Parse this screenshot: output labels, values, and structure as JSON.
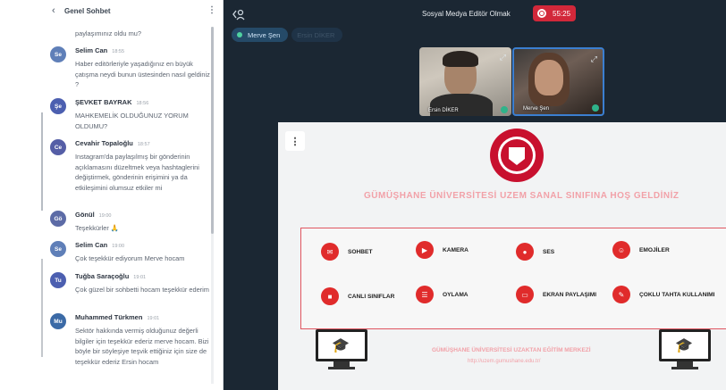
{
  "chat": {
    "title": "Genel Sohbet",
    "partial_text": "paylaşımınız oldu mu?",
    "messages": [
      {
        "initials": "Se",
        "name": "Selim Can",
        "time": "18:55",
        "text": "Haber editörleriyle yaşadığınız en büyük çatışma neydi bunun üstesinden nasıl geldiniz ?",
        "color": "#5f7fb8"
      },
      {
        "initials": "Şe",
        "name": "ŞEVKET BAYRAK",
        "time": "18:56",
        "text": "MAHKEMELİK OLDUĞUNUZ YORUM OLDUMU?",
        "color": "#4c5fb0"
      },
      {
        "initials": "Ce",
        "name": "Cevahir Topaloğlu",
        "time": "18:57",
        "text": "Instagram'da paylaşılmış bir gönderinin açıklamasını düzeltmek veya hashtaglerini değiştirmek, gönderinin erişimini ya da etkileşimini olumsuz etkiler mi",
        "color": "#555ea6"
      },
      {
        "initials": "Gö",
        "name": "Gönül",
        "time": "19:00",
        "text": "Teşekkürler 🙏",
        "color": "#5c6ba6"
      },
      {
        "initials": "Se",
        "name": "Selim Can",
        "time": "19:00",
        "text": "Çok teşekkür ediyorum Merve hocam",
        "color": "#5f7fb8"
      },
      {
        "initials": "Tu",
        "name": "Tuğba Saraçoğlu",
        "time": "19:01",
        "text": "Çok güzel bir sohbetti hocam teşekkür ederim",
        "color": "#4c5fb0"
      },
      {
        "initials": "Mu",
        "name": "Muhammed Türkmen",
        "time": "19:01",
        "text": "Sektör hakkında vermiş olduğunuz değerli bilgiler için teşekkür ederiz merve hocam. Bizi böyle bir söyleşiye teşvik ettiğiniz için size de teşekkür ederiz Ersin hocam",
        "color": "#3b6aa6"
      }
    ]
  },
  "room": {
    "title": "Sosyal Medya Editör Olmak",
    "timer": "55:25",
    "presenters": [
      "Merve Şen",
      "Ersin DİKER"
    ]
  },
  "videos": [
    {
      "label": "Ersin DİKER"
    },
    {
      "label": "Merve Şen"
    }
  ],
  "slide": {
    "welcome": "GÜMÜŞHANE ÜNİVERSİTESİ UZEM SANAL SINIFINA HOŞ GELDİNİZ",
    "features": [
      "SOHBET",
      "KAMERA",
      "SES",
      "EMOJİLER",
      "CANLI SINIFLAR",
      "OYLAMA",
      "EKRAN PAYLAŞIMI",
      "ÇOKLU TAHTA KULLANIMI"
    ],
    "footer_title": "GÜMÜŞHANE ÜNİVERSİTESİ UZAKTAN EĞİTİM MERKEZİ",
    "footer_url": "http://uzem.gumushane.edu.tr/"
  }
}
